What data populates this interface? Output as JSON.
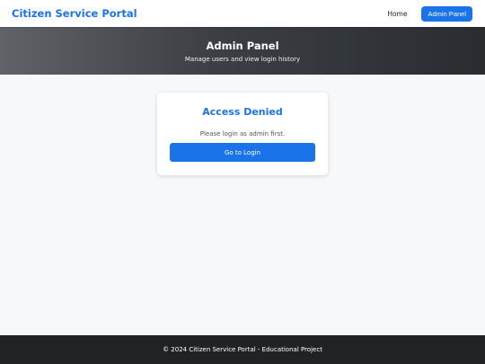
{
  "header": {
    "brand": "Citizen Service Portal",
    "nav": {
      "home_label": "Home",
      "admin_label": "Admin Panel"
    }
  },
  "hero": {
    "title": "Admin Panel",
    "subtitle": "Manage users and view login history"
  },
  "card": {
    "title": "Access Denied",
    "message": "Please login as admin first.",
    "button_label": "Go to Login"
  },
  "footer": {
    "text": "© 2024 Citizen Service Portal - Educational Project"
  },
  "colors": {
    "accent": "#1a73e8",
    "footer_bg": "#212225"
  }
}
